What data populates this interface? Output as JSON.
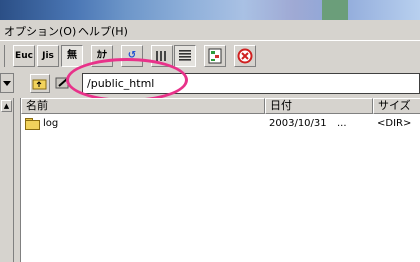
{
  "menubar": {
    "items": [
      "オプション(O)",
      "ヘルプ(H)"
    ]
  },
  "toolbar": {
    "buttons": [
      {
        "name": "euc-button",
        "label": "Euc"
      },
      {
        "name": "jis-button",
        "label": "Jis"
      },
      {
        "name": "no-conversion-button",
        "label": "無"
      },
      {
        "name": "kana-button",
        "label": "ｶﾅ"
      },
      {
        "name": "refresh-button",
        "label": "↺"
      },
      {
        "name": "list-view-button",
        "label": ""
      },
      {
        "name": "details-view-button",
        "label": ""
      },
      {
        "name": "sync-button",
        "label": ""
      },
      {
        "name": "stop-button",
        "label": ""
      }
    ]
  },
  "pathbar": {
    "path_value": "/public_html"
  },
  "filelist": {
    "columns": {
      "name": "名前",
      "date": "日付",
      "size": "サイズ"
    },
    "rows": [
      {
        "name": "log",
        "date": "2003/10/31",
        "extra": "...",
        "size": "<DIR>"
      }
    ]
  },
  "colors": {
    "highlight_ellipse": "#e8328a",
    "chrome": "#d6d3ce",
    "folder": "#f2d35c"
  }
}
